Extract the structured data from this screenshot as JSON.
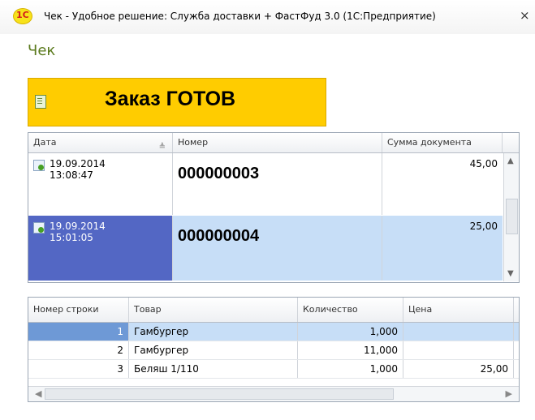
{
  "window": {
    "title": "Чек - Удобное решение: Служба доставки + ФастФуд 3.0  (1С:Предприятие)",
    "logo_text": "1С",
    "close_glyph": "×"
  },
  "form": {
    "title": "Чек"
  },
  "banner": {
    "text": "Заказ ГОТОВ",
    "color": "#ffcc00"
  },
  "documents": {
    "columns": {
      "date": "Дата",
      "number": "Номер",
      "sum": "Сумма документа"
    },
    "rows": [
      {
        "date": "19.09.2014",
        "time": "13:08:47",
        "number": "000000003",
        "sum": "45,00"
      },
      {
        "date": "19.09.2014",
        "time": "15:01:05",
        "number": "000000004",
        "sum": "25,00"
      }
    ],
    "selected_index": 1
  },
  "items": {
    "columns": {
      "line": "Номер строки",
      "product": "Товар",
      "quantity": "Количество",
      "price": "Цена"
    },
    "rows": [
      {
        "line": "1",
        "product": "Гамбургер",
        "quantity": "1,000",
        "price": ""
      },
      {
        "line": "2",
        "product": "Гамбургер",
        "quantity": "11,000",
        "price": ""
      },
      {
        "line": "3",
        "product": "Беляш 1/110",
        "quantity": "1,000",
        "price": "25,00"
      }
    ]
  }
}
